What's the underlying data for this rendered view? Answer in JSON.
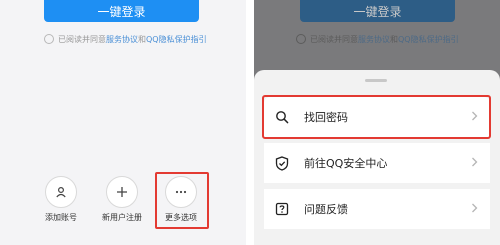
{
  "left_panel": {
    "login_button": "一键登录",
    "agreement": {
      "prefix": "已阅读并同意",
      "link1": "服务协议",
      "and": "和",
      "link2": "QQ隐私保护指引"
    },
    "actions": [
      {
        "label": "添加账号",
        "icon": "person-icon"
      },
      {
        "label": "新用户注册",
        "icon": "plus-icon"
      },
      {
        "label": "更多选项",
        "icon": "more-dots-icon"
      }
    ]
  },
  "right_panel": {
    "login_button": "一键登录",
    "agreement": {
      "prefix": "已阅读并同意",
      "link1": "服务协议",
      "and": "和",
      "link2": "QQ隐私保护指引"
    },
    "sheet_items": [
      {
        "label": "找回密码",
        "icon": "search-icon"
      },
      {
        "label": "前往QQ安全中心",
        "icon": "shield-check-icon"
      },
      {
        "label": "问题反馈",
        "icon": "question-icon"
      }
    ]
  },
  "colors": {
    "accent": "#1e8ff3",
    "highlight_border": "#e33a32"
  }
}
